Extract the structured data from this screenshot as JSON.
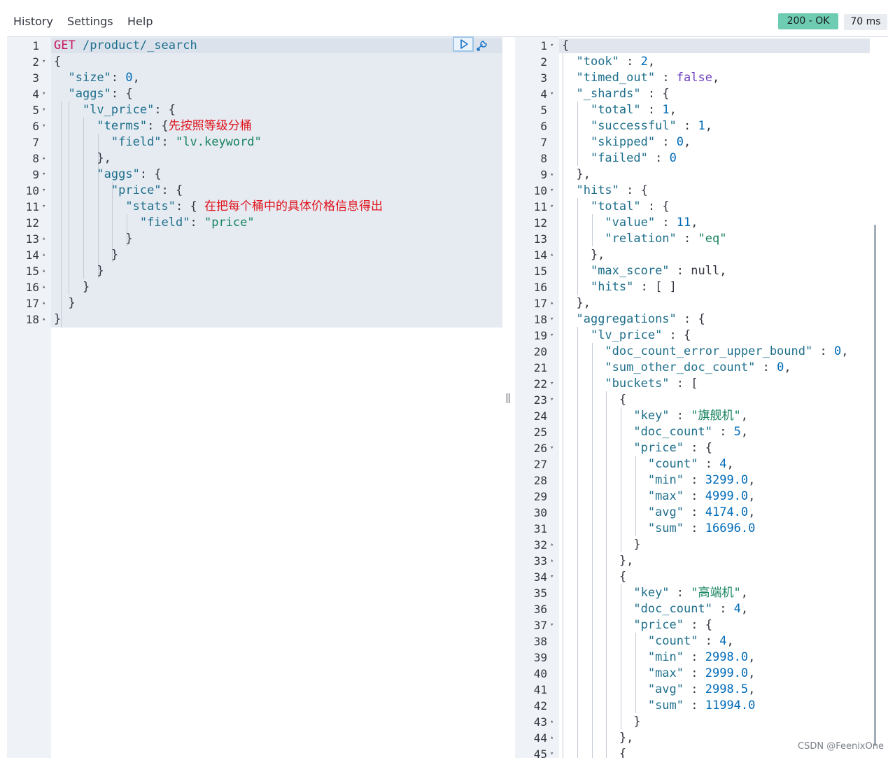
{
  "menu": {
    "history": "History",
    "settings": "Settings",
    "help": "Help"
  },
  "status": {
    "code": "200 - OK",
    "time": "70 ms"
  },
  "request": {
    "method": "GET",
    "path": "/product/_search",
    "annotation_terms": "先按照等级分桶",
    "annotation_stats": "在把每个桶中的具体价格信息得出",
    "lines": [
      {
        "n": "1",
        "fold": ""
      },
      {
        "n": "2",
        "fold": "▾"
      },
      {
        "n": "3",
        "fold": ""
      },
      {
        "n": "4",
        "fold": "▾"
      },
      {
        "n": "5",
        "fold": "▾"
      },
      {
        "n": "6",
        "fold": "▾"
      },
      {
        "n": "7",
        "fold": ""
      },
      {
        "n": "8",
        "fold": "▴"
      },
      {
        "n": "9",
        "fold": "▾"
      },
      {
        "n": "10",
        "fold": "▾"
      },
      {
        "n": "11",
        "fold": "▾"
      },
      {
        "n": "12",
        "fold": ""
      },
      {
        "n": "13",
        "fold": "▴"
      },
      {
        "n": "14",
        "fold": "▴"
      },
      {
        "n": "15",
        "fold": "▴"
      },
      {
        "n": "16",
        "fold": "▴"
      },
      {
        "n": "17",
        "fold": "▴"
      },
      {
        "n": "18",
        "fold": "▴"
      }
    ],
    "text": {
      "l2": "{",
      "l3k": "\"size\"",
      "l3v": "0",
      "l4k": "\"aggs\"",
      "l5k": "\"lv_price\"",
      "l6k": "\"terms\"",
      "l7k": "\"field\"",
      "l7v": "\"lv.keyword\"",
      "l8": "},",
      "l9k": "\"aggs\"",
      "l10k": "\"price\"",
      "l11k": "\"stats\"",
      "l12k": "\"field\"",
      "l12v": "\"price\"",
      "close": "}"
    }
  },
  "response": {
    "lines": [
      {
        "n": "1",
        "fold": "▾"
      },
      {
        "n": "2",
        "fold": ""
      },
      {
        "n": "3",
        "fold": ""
      },
      {
        "n": "4",
        "fold": "▾"
      },
      {
        "n": "5",
        "fold": ""
      },
      {
        "n": "6",
        "fold": ""
      },
      {
        "n": "7",
        "fold": ""
      },
      {
        "n": "8",
        "fold": ""
      },
      {
        "n": "9",
        "fold": "▴"
      },
      {
        "n": "10",
        "fold": "▾"
      },
      {
        "n": "11",
        "fold": "▾"
      },
      {
        "n": "12",
        "fold": ""
      },
      {
        "n": "13",
        "fold": ""
      },
      {
        "n": "14",
        "fold": "▴"
      },
      {
        "n": "15",
        "fold": ""
      },
      {
        "n": "16",
        "fold": ""
      },
      {
        "n": "17",
        "fold": "▴"
      },
      {
        "n": "18",
        "fold": "▾"
      },
      {
        "n": "19",
        "fold": "▾"
      },
      {
        "n": "20",
        "fold": ""
      },
      {
        "n": "21",
        "fold": ""
      },
      {
        "n": "22",
        "fold": "▾"
      },
      {
        "n": "23",
        "fold": "▾"
      },
      {
        "n": "24",
        "fold": ""
      },
      {
        "n": "25",
        "fold": ""
      },
      {
        "n": "26",
        "fold": "▾"
      },
      {
        "n": "27",
        "fold": ""
      },
      {
        "n": "28",
        "fold": ""
      },
      {
        "n": "29",
        "fold": ""
      },
      {
        "n": "30",
        "fold": ""
      },
      {
        "n": "31",
        "fold": ""
      },
      {
        "n": "32",
        "fold": "▴"
      },
      {
        "n": "33",
        "fold": "▴"
      },
      {
        "n": "34",
        "fold": "▾"
      },
      {
        "n": "35",
        "fold": ""
      },
      {
        "n": "36",
        "fold": ""
      },
      {
        "n": "37",
        "fold": "▾"
      },
      {
        "n": "38",
        "fold": ""
      },
      {
        "n": "39",
        "fold": ""
      },
      {
        "n": "40",
        "fold": ""
      },
      {
        "n": "41",
        "fold": ""
      },
      {
        "n": "42",
        "fold": ""
      },
      {
        "n": "43",
        "fold": "▴"
      },
      {
        "n": "44",
        "fold": "▴"
      },
      {
        "n": "45",
        "fold": "▾"
      }
    ],
    "took": "2",
    "timed_out": "false",
    "shards": {
      "total": "1",
      "successful": "1",
      "skipped": "0",
      "failed": "0"
    },
    "hits_total_value": "11",
    "hits_total_relation": "\"eq\"",
    "max_score": "null",
    "hits_hits": "[ ]",
    "doc_count_error_upper_bound": "0",
    "sum_other_doc_count": "0",
    "buckets": [
      {
        "key": "\"旗舰机\"",
        "doc_count": "5",
        "count": "4",
        "min": "3299.0",
        "max": "4999.0",
        "avg": "4174.0",
        "sum": "16696.0"
      },
      {
        "key": "\"高端机\"",
        "doc_count": "4",
        "count": "4",
        "min": "2998.0",
        "max": "2999.0",
        "avg": "2998.5",
        "sum": "11994.0"
      }
    ]
  },
  "watermark": "CSDN @FeenixOne",
  "icons": {
    "run": "play-icon",
    "wrench": "wrench-icon",
    "splitter": "drag-handle-icon"
  }
}
